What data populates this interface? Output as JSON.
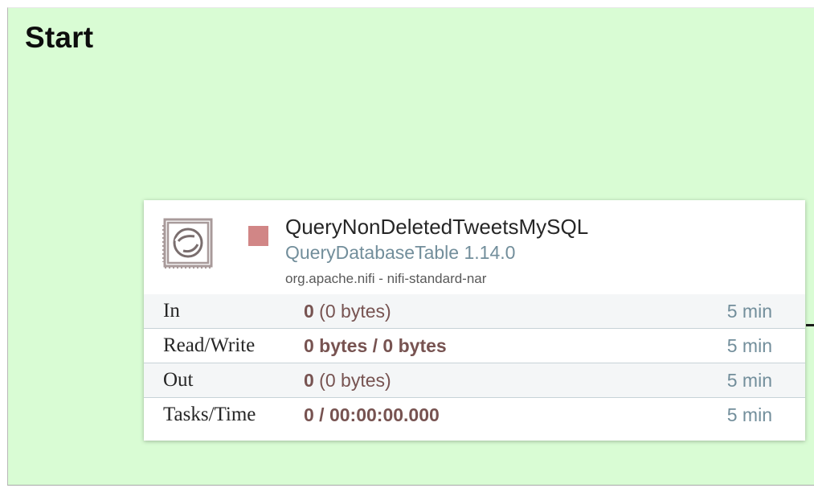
{
  "process_group": {
    "title": "Start",
    "background_color": "#d9fcd4"
  },
  "processor": {
    "icon": "processor-stamp-icon",
    "status": "stopped",
    "status_color": "#d18686",
    "name": "QueryNonDeletedTweetsMySQL",
    "type": "QueryDatabaseTable 1.14.0",
    "bundle": "org.apache.nifi - nifi-standard-nar",
    "stats": {
      "in": {
        "label": "In",
        "value_bold": "0",
        "value_rest": " (0 bytes)",
        "window": "5 min"
      },
      "read_write": {
        "label": "Read/Write",
        "value_bold": "0 bytes / 0 bytes",
        "value_rest": "",
        "window": "5 min"
      },
      "out": {
        "label": "Out",
        "value_bold": "0",
        "value_rest": " (0 bytes)",
        "window": "5 min"
      },
      "tasks_time": {
        "label": "Tasks/Time",
        "value_bold": "0 / 00:00:00.000",
        "value_rest": "",
        "window": "5 min"
      }
    }
  }
}
